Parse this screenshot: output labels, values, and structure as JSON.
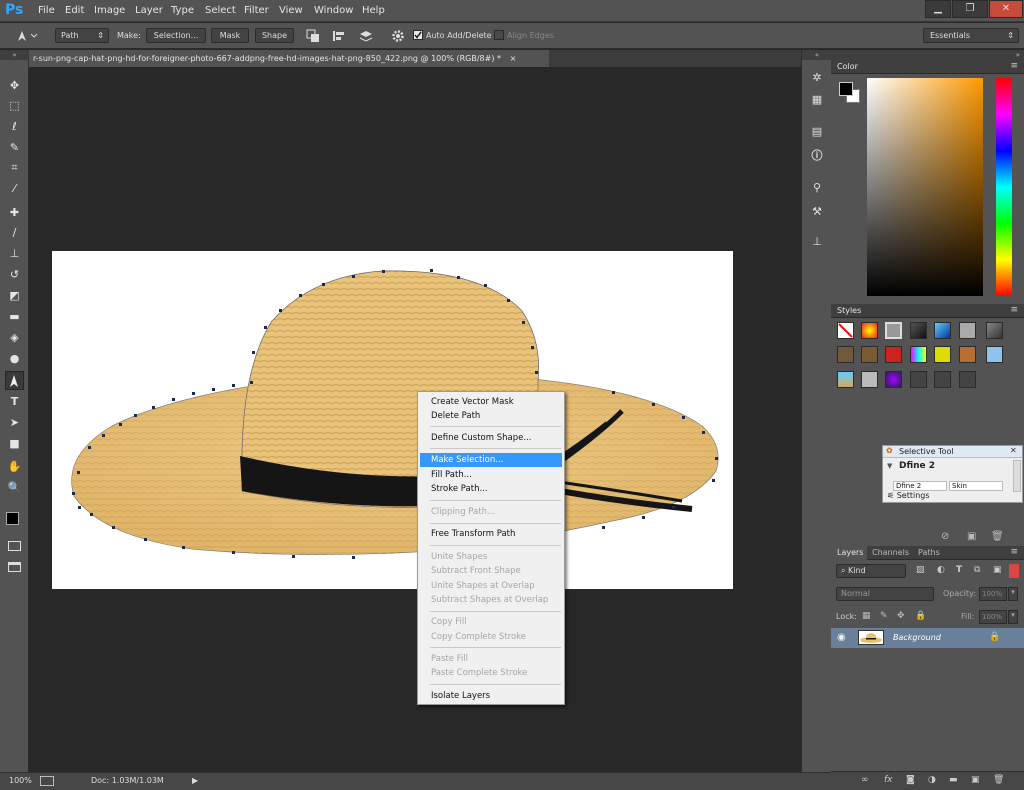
{
  "app": {
    "logo": "Ps",
    "menus": [
      "File",
      "Edit",
      "Image",
      "Layer",
      "Type",
      "Select",
      "Filter",
      "View",
      "Window",
      "Help"
    ],
    "window_buttons": [
      "▁",
      "❐",
      "✕"
    ]
  },
  "options_bar": {
    "mode": "Path",
    "make_label": "Make:",
    "selection_btn": "Selection...",
    "mask_btn": "Mask",
    "shape_btn": "Shape",
    "auto_add_delete": "Auto Add/Delete",
    "auto_add_delete_checked": true,
    "align_edges": "Align Edges",
    "align_edges_checked": false,
    "workspace": "Essentials"
  },
  "document": {
    "tab_title": "r-sun-png-cap-hat-png-hd-for-foreigner-photo-667-addpng-free-hd-images-hat-png-850_422.png @ 100% (RGB/8#) *",
    "tab_close": "×"
  },
  "toolbar": {
    "tools": [
      "move",
      "marquee",
      "lasso",
      "quick-select",
      "crop",
      "eyedropper",
      "healing",
      "brush",
      "stamp",
      "history-brush",
      "eraser",
      "gradient",
      "blur",
      "dodge",
      "pen",
      "type",
      "path-select",
      "shape",
      "hand",
      "zoom"
    ]
  },
  "context_menu": {
    "items": [
      {
        "label": "Create Vector Mask",
        "enabled": true
      },
      {
        "label": "Delete Path",
        "enabled": true
      },
      {
        "sep": true
      },
      {
        "label": "Define Custom Shape...",
        "enabled": true
      },
      {
        "sep": true
      },
      {
        "label": "Make Selection...",
        "enabled": true,
        "highlighted": true
      },
      {
        "label": "Fill Path...",
        "enabled": true
      },
      {
        "label": "Stroke Path...",
        "enabled": true
      },
      {
        "sep": true
      },
      {
        "label": "Clipping Path...",
        "enabled": false
      },
      {
        "sep": true
      },
      {
        "label": "Free Transform Path",
        "enabled": true
      },
      {
        "sep": true
      },
      {
        "label": "Unite Shapes",
        "enabled": false
      },
      {
        "label": "Subtract Front Shape",
        "enabled": false
      },
      {
        "label": "Unite Shapes at Overlap",
        "enabled": false
      },
      {
        "label": "Subtract Shapes at Overlap",
        "enabled": false
      },
      {
        "sep": true
      },
      {
        "label": "Copy Fill",
        "enabled": false
      },
      {
        "label": "Copy Complete Stroke",
        "enabled": false
      },
      {
        "sep": true
      },
      {
        "label": "Paste Fill",
        "enabled": false
      },
      {
        "label": "Paste Complete Stroke",
        "enabled": false
      },
      {
        "sep": true
      },
      {
        "label": "Isolate Layers",
        "enabled": true
      }
    ]
  },
  "status_bar": {
    "zoom": "100%",
    "doc": "Doc: 1.03M/1.03M",
    "arrow": "▶"
  },
  "color_panel": {
    "title": "Color"
  },
  "styles_panel": {
    "title": "Styles"
  },
  "selective_tool": {
    "title": "Selective Tool",
    "preset": "Dfine 2",
    "col1": "Dfine 2",
    "col2": "Skin",
    "settings": "Settings"
  },
  "layers_panel": {
    "tabs": [
      "Layers",
      "Channels",
      "Paths"
    ],
    "kind": "Kind",
    "blend_mode": "Normal",
    "opacity_label": "Opacity:",
    "opacity_value": "100%",
    "lock_label": "Lock:",
    "fill_label": "Fill:",
    "fill_value": "100%",
    "layer_name": "Background"
  },
  "colors": {
    "ui_bg": "#535353",
    "canvas_bg": "#282828",
    "highlight": "#3399ff",
    "layer_selected": "#6a7f99"
  }
}
